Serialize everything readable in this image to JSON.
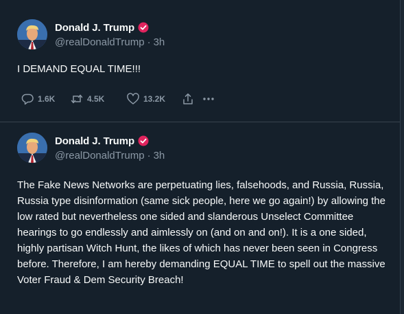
{
  "tweets": [
    {
      "author": "Donald J. Trump",
      "handle": "@realDonaldTrump",
      "time": "3h",
      "text": "I DEMAND EQUAL TIME!!!",
      "replies": "1.6K",
      "retweets": "4.5K",
      "likes": "13.2K"
    },
    {
      "author": "Donald J. Trump",
      "handle": "@realDonaldTrump",
      "time": "3h",
      "text": "The Fake News Networks are perpetuating lies, falsehoods, and Russia, Russia, Russia type disinformation (same sick people, here we go again!) by allowing the low rated but nevertheless one sided and slanderous Unselect Committee hearings to go endlessly and aimlessly on (and on and on!). It is a one sided, highly partisan Witch Hunt, the likes of which has never been seen in Congress before. Therefore, I am hereby demanding EQUAL TIME to spell out the massive Voter Fraud & Dem Security Breach!"
    }
  ],
  "separator": "·",
  "icons": {
    "verified": "verified-badge-icon",
    "reply": "reply-icon",
    "retweet": "retweet-icon",
    "like": "heart-icon",
    "share": "share-icon",
    "more": "more-icon"
  },
  "colors": {
    "background": "#15202b",
    "text": "#f7f9f9",
    "secondary": "#8b98a5",
    "badge": "#e0245e",
    "divider": "#38444d"
  }
}
